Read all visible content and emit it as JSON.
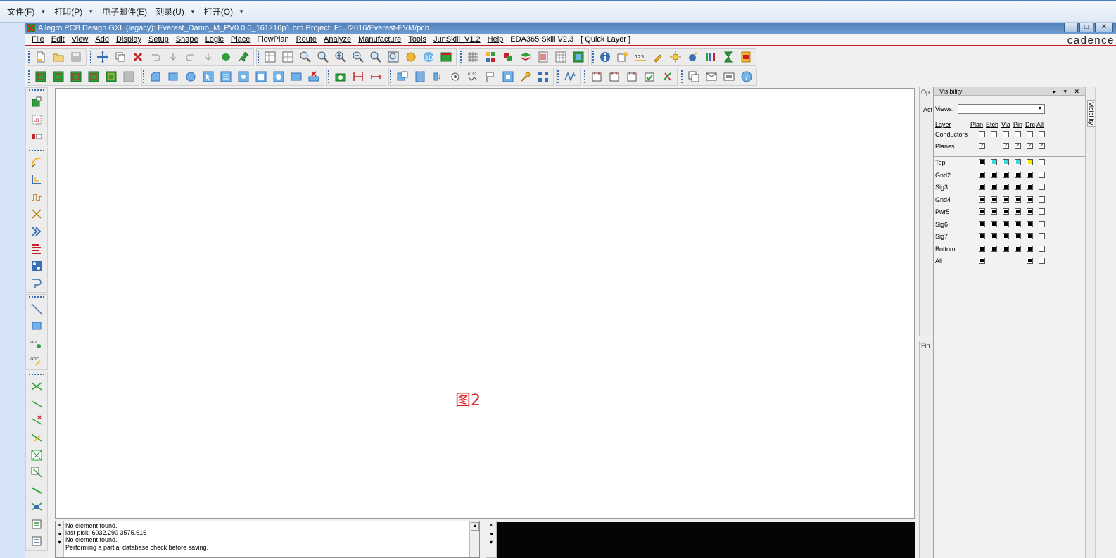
{
  "explorer": {
    "items": [
      {
        "label": "文件(F)"
      },
      {
        "label": "打印(P)"
      },
      {
        "label": "电子邮件(E)"
      },
      {
        "label": "刻录(U)"
      },
      {
        "label": "打开(O)"
      }
    ]
  },
  "window": {
    "title": "Allegro PCB Design GXL (legacy): Everest_Damo_M_PV0.0.0_161216p1.brd  Project: F:.../2016/Everest-EVM/pcb",
    "minimize": "–",
    "maximize": "□",
    "close": "✕"
  },
  "menu": {
    "items": [
      "File",
      "Edit",
      "View",
      "Add",
      "Display",
      "Setup",
      "Shape",
      "Logic",
      "Place",
      "FlowPlan",
      "Route",
      "Analyze",
      "Manufacture",
      "Tools",
      "JunSkill_V1.2",
      "Help",
      "EDA365 Skill V2.3",
      "[ Quick Layer ]"
    ],
    "logo": "cādence"
  },
  "canvas": {
    "label": "图2"
  },
  "options_panel": {
    "title": "Op",
    "act": "Act"
  },
  "find_panel": {
    "title": "Fin"
  },
  "visibility": {
    "title": "Visibility",
    "header_buttons": "▸ ▾ ✕",
    "views_label": "Views:",
    "side_tab": "Visibility",
    "columns": [
      "Layer",
      "Plan",
      "Etch",
      "Via",
      "Pin",
      "Drc",
      "All"
    ],
    "groups": [
      {
        "name": "Conductors",
        "states": [
          "empty",
          "empty",
          "empty",
          "empty",
          "empty",
          "empty"
        ]
      },
      {
        "name": "Planes",
        "states": [
          "check",
          "none",
          "check",
          "check",
          "check",
          "check"
        ]
      }
    ],
    "layers": [
      {
        "name": "Top",
        "states": [
          "black",
          "cyan",
          "cyan",
          "cyan",
          "yellow",
          "empty"
        ]
      },
      {
        "name": "Gnd2",
        "states": [
          "black",
          "black",
          "black",
          "black",
          "black",
          "empty"
        ]
      },
      {
        "name": "Sig3",
        "states": [
          "black",
          "black",
          "black",
          "black",
          "black",
          "empty"
        ]
      },
      {
        "name": "Gnd4",
        "states": [
          "black",
          "black",
          "black",
          "black",
          "black",
          "empty"
        ]
      },
      {
        "name": "Pwr5",
        "states": [
          "black",
          "black",
          "black",
          "black",
          "black",
          "empty"
        ]
      },
      {
        "name": "Sig6",
        "states": [
          "black",
          "black",
          "black",
          "black",
          "black",
          "empty"
        ]
      },
      {
        "name": "Sig7",
        "states": [
          "black",
          "black",
          "black",
          "black",
          "black",
          "empty"
        ]
      },
      {
        "name": "Bottom",
        "states": [
          "black",
          "black",
          "black",
          "black",
          "black",
          "empty"
        ]
      },
      {
        "name": "All",
        "states": [
          "black",
          "none",
          "none",
          "none",
          "black",
          "empty"
        ]
      }
    ]
  },
  "console": {
    "lines": [
      "No element found.",
      "last pick:  6032.290 3575.616",
      "No element found.",
      "Performing a partial database check before saving."
    ]
  },
  "colors": {
    "accent_red": "#c8202a",
    "canvas_label": "#e0282d",
    "title_blue": "#4e7fb8"
  }
}
